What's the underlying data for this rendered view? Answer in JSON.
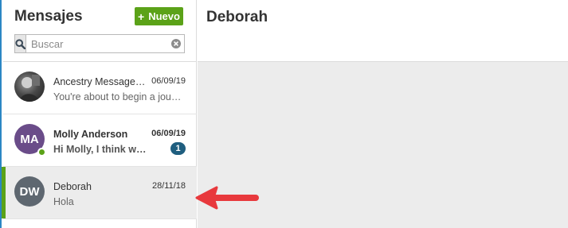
{
  "sidebar": {
    "title": "Mensajes",
    "new_button_label": "Nuevo",
    "search_placeholder": "Buscar",
    "conversations": [
      {
        "initials": "",
        "name": "Ancestry Messages T…",
        "date": "06/09/19",
        "preview": "You're about to begin a journ…",
        "unread": false,
        "badge": ""
      },
      {
        "initials": "MA",
        "name": "Molly Anderson",
        "date": "06/09/19",
        "preview": "Hi Molly, I think we…",
        "unread": true,
        "badge": "1"
      },
      {
        "initials": "DW",
        "name": "Deborah",
        "date": "28/11/18",
        "preview": "Hola",
        "unread": false,
        "badge": ""
      }
    ]
  },
  "main": {
    "title": "Deborah"
  },
  "colors": {
    "accent_green": "#5ba218",
    "badge_blue": "#1f5e7f",
    "annotation_red": "#e8393d"
  },
  "icons": [
    "plus-icon",
    "search-icon",
    "clear-icon",
    "online-status-icon",
    "annotation-arrow"
  ]
}
